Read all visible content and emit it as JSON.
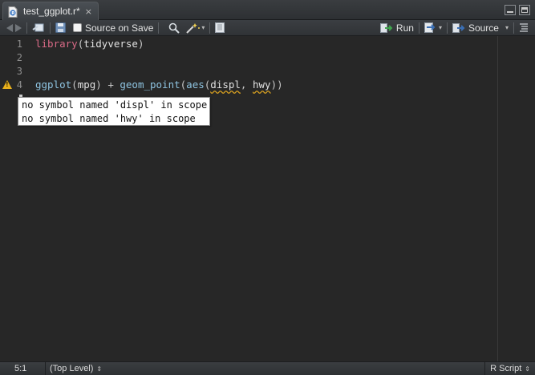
{
  "tab": {
    "title": "test_ggplot.r*",
    "close_glyph": "×"
  },
  "toolbar": {
    "source_on_save_label": "Source on Save",
    "run_label": "Run",
    "source_label": "Source"
  },
  "editor": {
    "line_numbers": [
      "1",
      "2",
      "3",
      "4",
      "5"
    ],
    "line1": {
      "keyword": "library",
      "open": "(",
      "arg": "tidyverse",
      "close": ")"
    },
    "line4": {
      "fn1": "ggplot",
      "p1": "(",
      "arg1": "mpg",
      "p2": ")",
      "plus": " + ",
      "fn2": "geom_point",
      "p3": "(",
      "fn3": "aes",
      "p4": "(",
      "arg2": "displ",
      "comma": ", ",
      "arg3": "hwy",
      "p5": "))"
    },
    "tooltip": [
      "no symbol named 'displ' in scope",
      "no symbol named 'hwy' in scope"
    ]
  },
  "status": {
    "position": "5:1",
    "scope": "(Top Level)",
    "file_type": "R Script",
    "updown_glyph": "⇕"
  },
  "colors": {
    "keyword": "#d86a86",
    "function": "#8ec3e0",
    "warning": "#e8b01c"
  }
}
